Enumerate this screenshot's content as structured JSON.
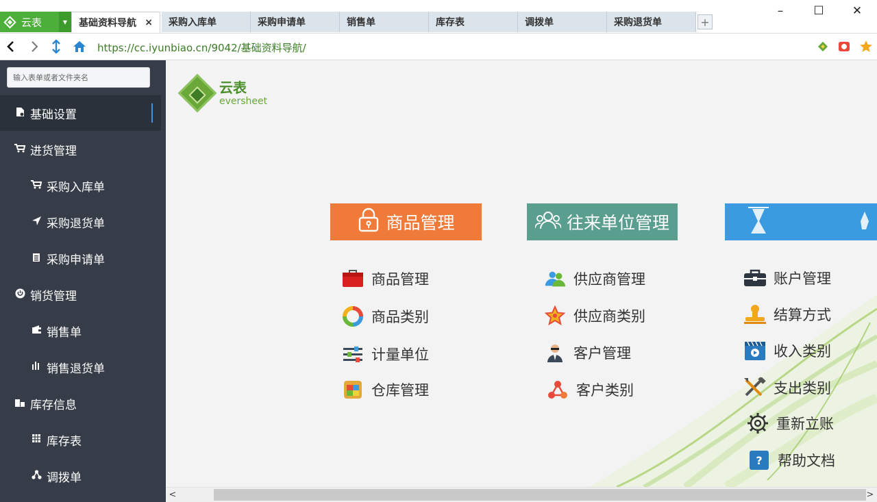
{
  "window": {
    "app_name": "云表",
    "minimize": "–",
    "maximize": "☐",
    "close": "✕"
  },
  "tabs": [
    {
      "label": "基础资料导航",
      "close": "×",
      "active": true
    },
    {
      "label": "采购入库单"
    },
    {
      "label": "采购申请单"
    },
    {
      "label": "销售单"
    },
    {
      "label": "库存表"
    },
    {
      "label": "调拨单"
    },
    {
      "label": "采购退货单"
    }
  ],
  "tab_add": "+",
  "address": {
    "url": "https://cc.iyunbiao.cn/9042/基础资料导航/"
  },
  "sidebar": {
    "search_placeholder": "输入表单或者文件夹名",
    "items": [
      {
        "label": "基础设置",
        "icon": "document-icon",
        "level": 1,
        "active": true
      },
      {
        "label": "进货管理",
        "icon": "cart-icon",
        "level": 1
      },
      {
        "label": "采购入库单",
        "icon": "cart-icon",
        "level": 2
      },
      {
        "label": "采购退货单",
        "icon": "send-icon",
        "level": 2
      },
      {
        "label": "采购申请单",
        "icon": "clipboard-icon",
        "level": 2
      },
      {
        "label": "销货管理",
        "icon": "power-icon",
        "level": 1
      },
      {
        "label": "销售单",
        "icon": "wallet-icon",
        "level": 2
      },
      {
        "label": "销售退货单",
        "icon": "bars-icon",
        "level": 2
      },
      {
        "label": "库存信息",
        "icon": "building-icon",
        "level": 1
      },
      {
        "label": "库存表",
        "icon": "grid-icon",
        "level": 2
      },
      {
        "label": "调拨单",
        "icon": "sitemap-icon",
        "level": 2
      }
    ]
  },
  "brand": {
    "cn": "云表",
    "en": "eversheet"
  },
  "sections": [
    {
      "title": "商品管理",
      "icon": "lock-icon",
      "color": "#f07a3a",
      "links": [
        {
          "label": "商品管理",
          "icon": "bag-icon"
        },
        {
          "label": "商品类别",
          "icon": "ring-icon"
        },
        {
          "label": "计量单位",
          "icon": "sliders-icon"
        },
        {
          "label": "仓库管理",
          "icon": "warehouse-icon"
        }
      ]
    },
    {
      "title": "往来单位管理",
      "icon": "users-icon",
      "color": "#5a9e8f",
      "links": [
        {
          "label": "供应商管理",
          "icon": "people-icon"
        },
        {
          "label": "供应商类别",
          "icon": "star-icon"
        },
        {
          "label": "客户管理",
          "icon": "person-icon"
        },
        {
          "label": "客户类别",
          "icon": "nodes-icon"
        }
      ]
    },
    {
      "title": "",
      "icon": "",
      "color": "#3a9be0",
      "links": [
        {
          "label": "账户管理",
          "icon": "briefcase-icon"
        },
        {
          "label": "结算方式",
          "icon": "stamp-icon"
        },
        {
          "label": "收入类别",
          "icon": "video-icon"
        },
        {
          "label": "支出类别",
          "icon": "tools-icon"
        },
        {
          "label": "重新立账",
          "icon": "gear-icon"
        },
        {
          "label": "帮助文档",
          "icon": "help-icon"
        }
      ]
    }
  ],
  "scroll": {
    "left": "<",
    "right": ">"
  }
}
